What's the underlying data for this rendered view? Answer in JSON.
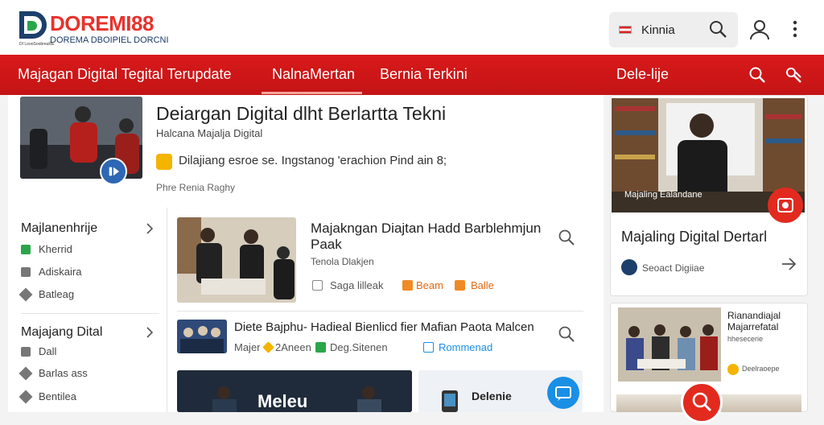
{
  "header": {
    "brand_name": "DOREMI88",
    "brand_tagline": "DOREMA DBOIPIEL DORCNI",
    "brand_small": "DI LoooSoobreuRE",
    "language_label": "Kinnia"
  },
  "nav": {
    "items": [
      {
        "label": "Majagan Digital Tegital Terupdate"
      },
      {
        "label": "NalnaMertan"
      },
      {
        "label": "Bernia Terkini"
      },
      {
        "label": "Dele-lije"
      }
    ]
  },
  "hero": {
    "title": "Deiargan Digital dlht Berlartta Tekni",
    "subtitle": "Halcana Majalja Digital",
    "meta": "Dilajiang esroe se. Ingstanog 'erachion Pind ain 8;",
    "byline": "Phre Renia Raghy"
  },
  "sidebar": {
    "section1": {
      "heading": "Majlanenhrije",
      "items": [
        "Kherrid",
        "Adiskaira",
        "Batleag"
      ]
    },
    "section2": {
      "heading": "Majajang Dital",
      "items": [
        "Dall",
        "Barlas ass",
        "Bentilea"
      ]
    }
  },
  "articles": [
    {
      "title": "Majakngan Diajtan Hadd Barblehmjun Paak",
      "source": "Tenola Dlakjen",
      "meta": [
        "Saga lilleak",
        "Beam",
        "Balle"
      ]
    },
    {
      "title": "Diete Bajphu- Hadieal Bienlicd fier Mafian Paota Malcen",
      "meta": [
        "Majer",
        "2Aneen",
        "Deg.Sitenen",
        "Rommenad"
      ]
    },
    {
      "title": "Delenie",
      "overlay": "Meleu"
    }
  ],
  "cards": {
    "card1": {
      "image_caption": "Majaling Ealandane",
      "title": "Majaling Digital Dertarl",
      "source": "Seoact Digiiae"
    },
    "card2": {
      "title": "Rianandiajal Majarrefatal",
      "sub": "hhesecerie",
      "meta": "Deelraoepe"
    }
  },
  "colors": {
    "brand_red": "#d8191a",
    "brand_blue": "#1d3f6b",
    "accent_orange": "#f4b400"
  }
}
